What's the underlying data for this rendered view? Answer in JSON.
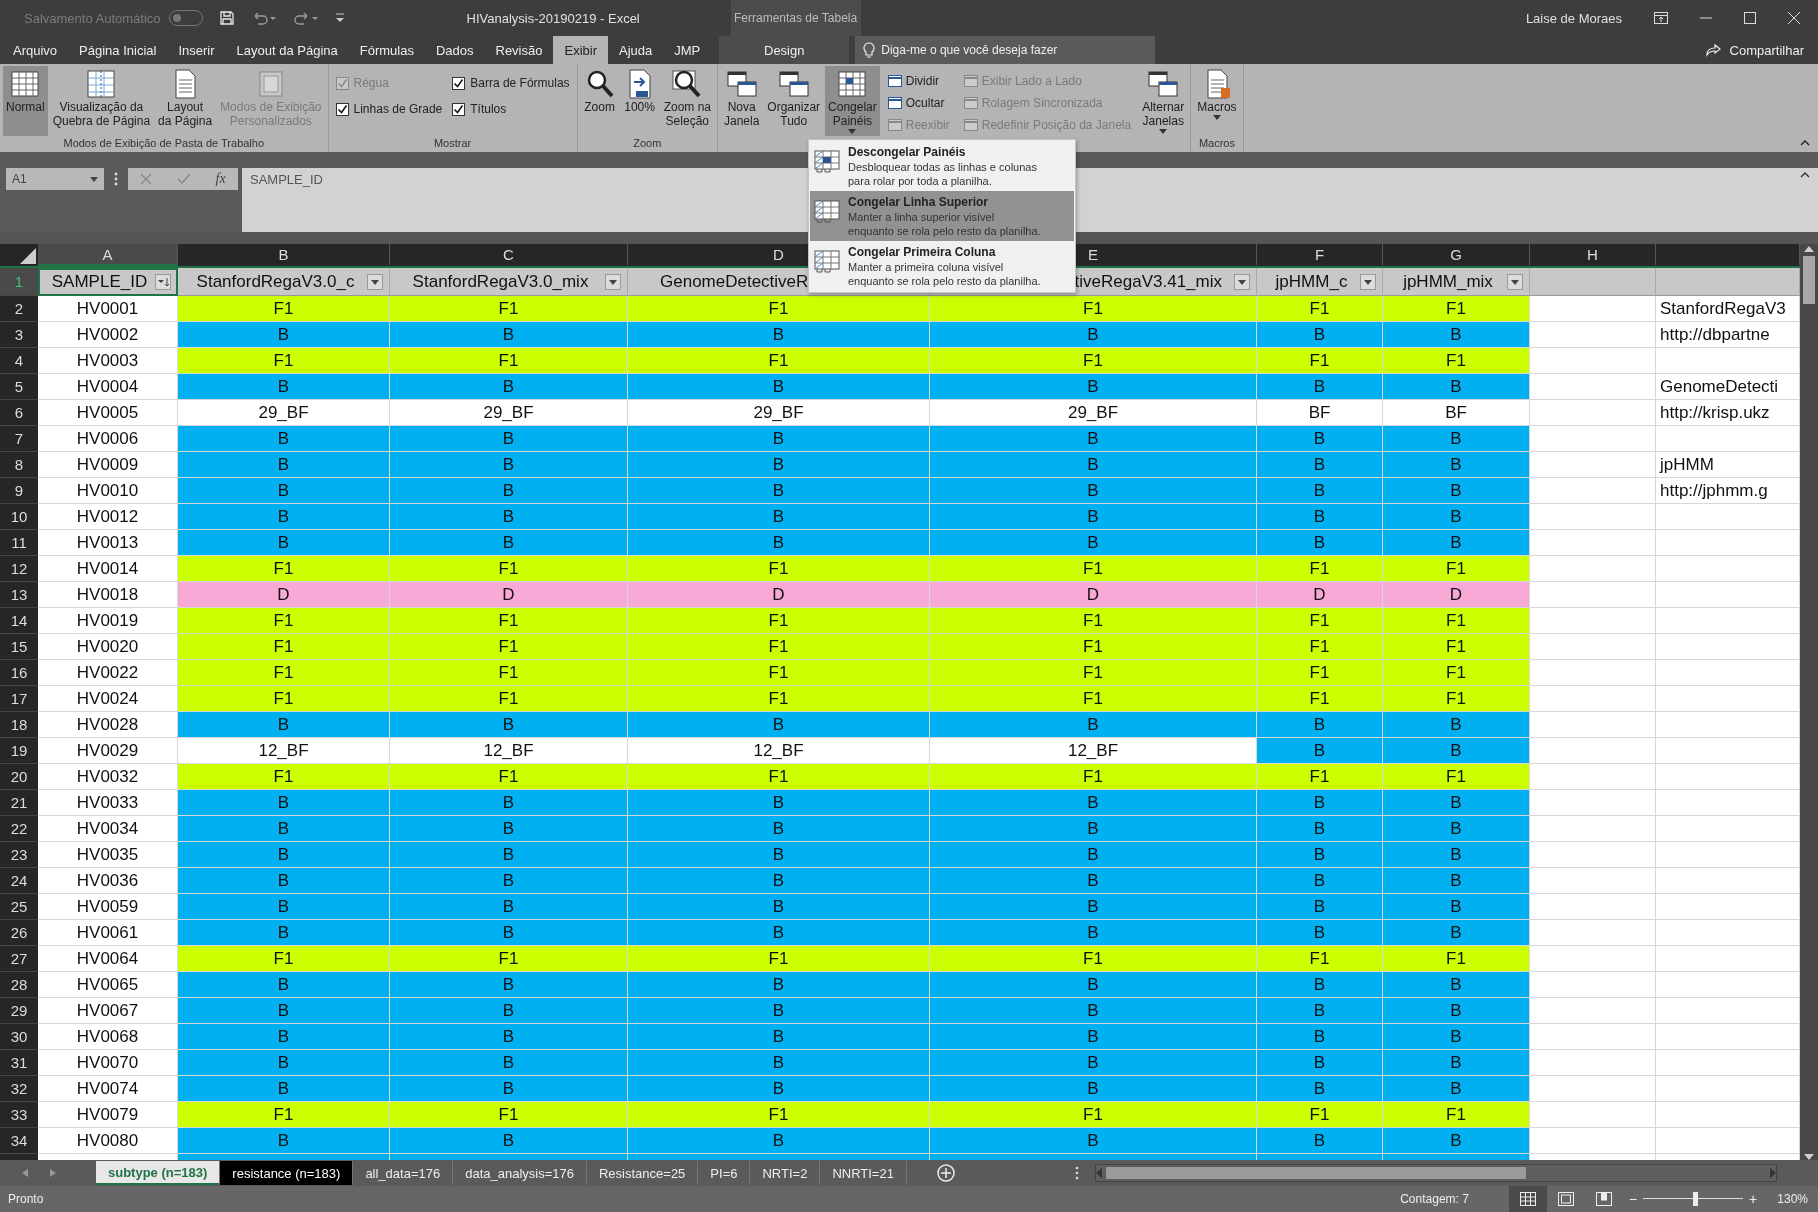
{
  "title_bar": {
    "autosave_label": "Salvamento Automático",
    "autosave_on": false,
    "title": "HIVanalysis-20190219  -  Excel",
    "context_label": "Ferramentas de Tabela",
    "user": "Laise de Moraes"
  },
  "tabs": [
    {
      "label": "Arquivo",
      "selected": false
    },
    {
      "label": "Página Inicial",
      "selected": false
    },
    {
      "label": "Inserir",
      "selected": false
    },
    {
      "label": "Layout da Página",
      "selected": false
    },
    {
      "label": "Fórmulas",
      "selected": false
    },
    {
      "label": "Dados",
      "selected": false
    },
    {
      "label": "Revisão",
      "selected": false
    },
    {
      "label": "Exibir",
      "selected": true
    },
    {
      "label": "Ajuda",
      "selected": false
    },
    {
      "label": "JMP",
      "selected": false
    }
  ],
  "context_tabs": [
    {
      "label": "Design",
      "selected": false
    }
  ],
  "tell_me": "Diga-me o que você deseja fazer",
  "share": "Compartilhar",
  "ribbon_groups": [
    {
      "label": "Modos de Exibição de Pasta de Trabalho",
      "items": [
        {
          "kind": "large",
          "label": "Normal",
          "selected": true,
          "disabled": false,
          "has_menu": false
        },
        {
          "kind": "large",
          "label": "Visualização da\nQuebra de Página",
          "selected": false,
          "disabled": false,
          "has_menu": false
        },
        {
          "kind": "large",
          "label": "Layout\nda Página",
          "selected": false,
          "disabled": false,
          "has_menu": false
        },
        {
          "kind": "large",
          "label": "Modos de Exibição\nPersonalizados",
          "selected": false,
          "disabled": true,
          "has_menu": false
        }
      ]
    },
    {
      "label": "Mostrar",
      "items": [
        {
          "kind": "stack",
          "items": [
            {
              "kind": "check",
              "label": "Régua",
              "checked": true,
              "disabled": true
            },
            {
              "kind": "check",
              "label": "Linhas de Grade",
              "checked": true,
              "disabled": false
            }
          ]
        },
        {
          "kind": "stack",
          "items": [
            {
              "kind": "check",
              "label": "Barra de Fórmulas",
              "checked": true,
              "disabled": false
            },
            {
              "kind": "check",
              "label": "Títulos",
              "checked": true,
              "disabled": false
            }
          ]
        }
      ]
    },
    {
      "label": "Zoom",
      "items": [
        {
          "kind": "large",
          "label": "Zoom",
          "selected": false,
          "disabled": false,
          "has_menu": false
        },
        {
          "kind": "large",
          "label": "100%",
          "selected": false,
          "disabled": false,
          "has_menu": false
        },
        {
          "kind": "large",
          "label": "Zoom na\nSeleção",
          "selected": false,
          "disabled": false,
          "has_menu": false
        }
      ]
    },
    {
      "items": [
        {
          "kind": "large",
          "label": "Nova\nJanela",
          "selected": false,
          "disabled": false,
          "has_menu": false
        },
        {
          "kind": "large",
          "label": "Organizar\nTudo",
          "selected": false,
          "disabled": false,
          "has_menu": false
        },
        {
          "kind": "large",
          "label": "Congelar\nPainéis",
          "selected": true,
          "disabled": false,
          "has_menu": true
        },
        {
          "kind": "stack",
          "items": [
            {
              "kind": "small",
              "label": "Dividir",
              "disabled": false
            },
            {
              "kind": "small",
              "label": "Ocultar",
              "disabled": false
            },
            {
              "kind": "small",
              "label": "Reexibir",
              "disabled": true
            }
          ]
        },
        {
          "kind": "stack",
          "items": [
            {
              "kind": "small",
              "label": "Exibir Lado a Lado",
              "disabled": true
            },
            {
              "kind": "small",
              "label": "Rolagem Sincronizada",
              "disabled": true
            },
            {
              "kind": "small",
              "label": "Redefinir Posição da Janela",
              "disabled": true
            }
          ]
        },
        {
          "kind": "large",
          "label": "Alternar\nJanelas",
          "selected": false,
          "disabled": false,
          "has_menu": true
        }
      ]
    },
    {
      "label": "Macros",
      "items": [
        {
          "kind": "large",
          "label": "Macros",
          "selected": false,
          "disabled": false,
          "has_menu": true
        }
      ]
    }
  ],
  "freeze_menu": [
    {
      "title": "Descongelar Painéis",
      "description": "Desbloquear todas as linhas e colunas\npara rolar por toda a planilha.",
      "selected": false
    },
    {
      "title": "Congelar Linha Superior",
      "description": "Manter a linha superior visível\nenquanto se rola pelo resto da planilha.",
      "selected": true
    },
    {
      "title": "Congelar Primeira Coluna",
      "description": "Manter a primeira coluna visível\nenquanto se rola pelo resto da planilha.",
      "selected": false
    }
  ],
  "formula_bar": {
    "name_box": "A1",
    "fx": "fx",
    "formula": "SAMPLE_ID"
  },
  "sheet": {
    "columns": [
      {
        "letter": "A",
        "selected": true
      },
      {
        "letter": "B",
        "selected": false
      },
      {
        "letter": "C",
        "selected": false
      },
      {
        "letter": "D",
        "selected": false
      },
      {
        "letter": "E",
        "selected": false
      },
      {
        "letter": "F",
        "selected": false
      },
      {
        "letter": "G",
        "selected": false
      },
      {
        "letter": "H",
        "selected": false
      }
    ],
    "header_row": {
      "number": "1",
      "selected": true,
      "cells": [
        {
          "text": "SAMPLE_ID",
          "filter": true
        },
        {
          "text": "StanfordRegaV3.0_c",
          "filter": true
        },
        {
          "text": "StanfordRegaV3.0_mix",
          "filter": true
        },
        {
          "text": "GenomeDetectiveR",
          "filter": false
        },
        {
          "text": "tiveRegaV3.41_mix",
          "filter": true
        },
        {
          "text": "jpHMM_c",
          "filter": true
        },
        {
          "text": "jpHMM_mix",
          "filter": true
        }
      ]
    },
    "rows": [
      {
        "number": "2",
        "id": "HV0001",
        "values": [
          {
            "text": "F1",
            "color": "#ccff00"
          },
          {
            "text": "F1",
            "color": "#ccff00"
          },
          {
            "text": "F1",
            "color": "#ccff00"
          },
          {
            "text": "F1",
            "color": "#ccff00"
          },
          {
            "text": "F1",
            "color": "#ccff00"
          },
          {
            "text": "F1",
            "color": "#ccff00"
          }
        ],
        "note": "StanfordRegaV3"
      },
      {
        "number": "3",
        "id": "HV0002",
        "values": [
          {
            "text": "B",
            "color": "#00b0f0"
          },
          {
            "text": "B",
            "color": "#00b0f0"
          },
          {
            "text": "B",
            "color": "#00b0f0"
          },
          {
            "text": "B",
            "color": "#00b0f0"
          },
          {
            "text": "B",
            "color": "#00b0f0"
          },
          {
            "text": "B",
            "color": "#00b0f0"
          }
        ],
        "note": "http://dbpartne"
      },
      {
        "number": "4",
        "id": "HV0003",
        "values": [
          {
            "text": "F1",
            "color": "#ccff00"
          },
          {
            "text": "F1",
            "color": "#ccff00"
          },
          {
            "text": "F1",
            "color": "#ccff00"
          },
          {
            "text": "F1",
            "color": "#ccff00"
          },
          {
            "text": "F1",
            "color": "#ccff00"
          },
          {
            "text": "F1",
            "color": "#ccff00"
          }
        ]
      },
      {
        "number": "5",
        "id": "HV0004",
        "values": [
          {
            "text": "B",
            "color": "#00b0f0"
          },
          {
            "text": "B",
            "color": "#00b0f0"
          },
          {
            "text": "B",
            "color": "#00b0f0"
          },
          {
            "text": "B",
            "color": "#00b0f0"
          },
          {
            "text": "B",
            "color": "#00b0f0"
          },
          {
            "text": "B",
            "color": "#00b0f0"
          }
        ],
        "note": "GenomeDetecti"
      },
      {
        "number": "6",
        "id": "HV0005",
        "values": [
          {
            "text": "29_BF",
            "color": "#ffffff"
          },
          {
            "text": "29_BF",
            "color": "#ffffff"
          },
          {
            "text": "29_BF",
            "color": "#ffffff"
          },
          {
            "text": "29_BF",
            "color": "#ffffff"
          },
          {
            "text": "BF",
            "color": "#ffffff"
          },
          {
            "text": "BF",
            "color": "#ffffff"
          }
        ],
        "note": "http://krisp.ukz"
      },
      {
        "number": "7",
        "id": "HV0006",
        "values": [
          {
            "text": "B",
            "color": "#00b0f0"
          },
          {
            "text": "B",
            "color": "#00b0f0"
          },
          {
            "text": "B",
            "color": "#00b0f0"
          },
          {
            "text": "B",
            "color": "#00b0f0"
          },
          {
            "text": "B",
            "color": "#00b0f0"
          },
          {
            "text": "B",
            "color": "#00b0f0"
          }
        ]
      },
      {
        "number": "8",
        "id": "HV0009",
        "values": [
          {
            "text": "B",
            "color": "#00b0f0"
          },
          {
            "text": "B",
            "color": "#00b0f0"
          },
          {
            "text": "B",
            "color": "#00b0f0"
          },
          {
            "text": "B",
            "color": "#00b0f0"
          },
          {
            "text": "B",
            "color": "#00b0f0"
          },
          {
            "text": "B",
            "color": "#00b0f0"
          }
        ],
        "note": "jpHMM"
      },
      {
        "number": "9",
        "id": "HV0010",
        "values": [
          {
            "text": "B",
            "color": "#00b0f0"
          },
          {
            "text": "B",
            "color": "#00b0f0"
          },
          {
            "text": "B",
            "color": "#00b0f0"
          },
          {
            "text": "B",
            "color": "#00b0f0"
          },
          {
            "text": "B",
            "color": "#00b0f0"
          },
          {
            "text": "B",
            "color": "#00b0f0"
          }
        ],
        "note": "http://jphmm.g"
      },
      {
        "number": "10",
        "id": "HV0012",
        "values": [
          {
            "text": "B",
            "color": "#00b0f0"
          },
          {
            "text": "B",
            "color": "#00b0f0"
          },
          {
            "text": "B",
            "color": "#00b0f0"
          },
          {
            "text": "B",
            "color": "#00b0f0"
          },
          {
            "text": "B",
            "color": "#00b0f0"
          },
          {
            "text": "B",
            "color": "#00b0f0"
          }
        ]
      },
      {
        "number": "11",
        "id": "HV0013",
        "values": [
          {
            "text": "B",
            "color": "#00b0f0"
          },
          {
            "text": "B",
            "color": "#00b0f0"
          },
          {
            "text": "B",
            "color": "#00b0f0"
          },
          {
            "text": "B",
            "color": "#00b0f0"
          },
          {
            "text": "B",
            "color": "#00b0f0"
          },
          {
            "text": "B",
            "color": "#00b0f0"
          }
        ]
      },
      {
        "number": "12",
        "id": "HV0014",
        "values": [
          {
            "text": "F1",
            "color": "#ccff00"
          },
          {
            "text": "F1",
            "color": "#ccff00"
          },
          {
            "text": "F1",
            "color": "#ccff00"
          },
          {
            "text": "F1",
            "color": "#ccff00"
          },
          {
            "text": "F1",
            "color": "#ccff00"
          },
          {
            "text": "F1",
            "color": "#ccff00"
          }
        ]
      },
      {
        "number": "13",
        "id": "HV0018",
        "values": [
          {
            "text": "D",
            "color": "#f9a9d6"
          },
          {
            "text": "D",
            "color": "#f9a9d6"
          },
          {
            "text": "D",
            "color": "#f9a9d6"
          },
          {
            "text": "D",
            "color": "#f9a9d6"
          },
          {
            "text": "D",
            "color": "#f9a9d6"
          },
          {
            "text": "D",
            "color": "#f9a9d6"
          }
        ]
      },
      {
        "number": "14",
        "id": "HV0019",
        "values": [
          {
            "text": "F1",
            "color": "#ccff00"
          },
          {
            "text": "F1",
            "color": "#ccff00"
          },
          {
            "text": "F1",
            "color": "#ccff00"
          },
          {
            "text": "F1",
            "color": "#ccff00"
          },
          {
            "text": "F1",
            "color": "#ccff00"
          },
          {
            "text": "F1",
            "color": "#ccff00"
          }
        ]
      },
      {
        "number": "15",
        "id": "HV0020",
        "values": [
          {
            "text": "F1",
            "color": "#ccff00"
          },
          {
            "text": "F1",
            "color": "#ccff00"
          },
          {
            "text": "F1",
            "color": "#ccff00"
          },
          {
            "text": "F1",
            "color": "#ccff00"
          },
          {
            "text": "F1",
            "color": "#ccff00"
          },
          {
            "text": "F1",
            "color": "#ccff00"
          }
        ]
      },
      {
        "number": "16",
        "id": "HV0022",
        "values": [
          {
            "text": "F1",
            "color": "#ccff00"
          },
          {
            "text": "F1",
            "color": "#ccff00"
          },
          {
            "text": "F1",
            "color": "#ccff00"
          },
          {
            "text": "F1",
            "color": "#ccff00"
          },
          {
            "text": "F1",
            "color": "#ccff00"
          },
          {
            "text": "F1",
            "color": "#ccff00"
          }
        ]
      },
      {
        "number": "17",
        "id": "HV0024",
        "values": [
          {
            "text": "F1",
            "color": "#ccff00"
          },
          {
            "text": "F1",
            "color": "#ccff00"
          },
          {
            "text": "F1",
            "color": "#ccff00"
          },
          {
            "text": "F1",
            "color": "#ccff00"
          },
          {
            "text": "F1",
            "color": "#ccff00"
          },
          {
            "text": "F1",
            "color": "#ccff00"
          }
        ]
      },
      {
        "number": "18",
        "id": "HV0028",
        "values": [
          {
            "text": "B",
            "color": "#00b0f0"
          },
          {
            "text": "B",
            "color": "#00b0f0"
          },
          {
            "text": "B",
            "color": "#00b0f0"
          },
          {
            "text": "B",
            "color": "#00b0f0"
          },
          {
            "text": "B",
            "color": "#00b0f0"
          },
          {
            "text": "B",
            "color": "#00b0f0"
          }
        ]
      },
      {
        "number": "19",
        "id": "HV0029",
        "values": [
          {
            "text": "12_BF",
            "color": "#ffffff"
          },
          {
            "text": "12_BF",
            "color": "#ffffff"
          },
          {
            "text": "12_BF",
            "color": "#ffffff"
          },
          {
            "text": "12_BF",
            "color": "#ffffff"
          },
          {
            "text": "B",
            "color": "#00b0f0"
          },
          {
            "text": "B",
            "color": "#00b0f0"
          }
        ]
      },
      {
        "number": "20",
        "id": "HV0032",
        "values": [
          {
            "text": "F1",
            "color": "#ccff00"
          },
          {
            "text": "F1",
            "color": "#ccff00"
          },
          {
            "text": "F1",
            "color": "#ccff00"
          },
          {
            "text": "F1",
            "color": "#ccff00"
          },
          {
            "text": "F1",
            "color": "#ccff00"
          },
          {
            "text": "F1",
            "color": "#ccff00"
          }
        ]
      },
      {
        "number": "21",
        "id": "HV0033",
        "values": [
          {
            "text": "B",
            "color": "#00b0f0"
          },
          {
            "text": "B",
            "color": "#00b0f0"
          },
          {
            "text": "B",
            "color": "#00b0f0"
          },
          {
            "text": "B",
            "color": "#00b0f0"
          },
          {
            "text": "B",
            "color": "#00b0f0"
          },
          {
            "text": "B",
            "color": "#00b0f0"
          }
        ]
      },
      {
        "number": "22",
        "id": "HV0034",
        "values": [
          {
            "text": "B",
            "color": "#00b0f0"
          },
          {
            "text": "B",
            "color": "#00b0f0"
          },
          {
            "text": "B",
            "color": "#00b0f0"
          },
          {
            "text": "B",
            "color": "#00b0f0"
          },
          {
            "text": "B",
            "color": "#00b0f0"
          },
          {
            "text": "B",
            "color": "#00b0f0"
          }
        ]
      },
      {
        "number": "23",
        "id": "HV0035",
        "values": [
          {
            "text": "B",
            "color": "#00b0f0"
          },
          {
            "text": "B",
            "color": "#00b0f0"
          },
          {
            "text": "B",
            "color": "#00b0f0"
          },
          {
            "text": "B",
            "color": "#00b0f0"
          },
          {
            "text": "B",
            "color": "#00b0f0"
          },
          {
            "text": "B",
            "color": "#00b0f0"
          }
        ]
      },
      {
        "number": "24",
        "id": "HV0036",
        "values": [
          {
            "text": "B",
            "color": "#00b0f0"
          },
          {
            "text": "B",
            "color": "#00b0f0"
          },
          {
            "text": "B",
            "color": "#00b0f0"
          },
          {
            "text": "B",
            "color": "#00b0f0"
          },
          {
            "text": "B",
            "color": "#00b0f0"
          },
          {
            "text": "B",
            "color": "#00b0f0"
          }
        ]
      },
      {
        "number": "25",
        "id": "HV0059",
        "values": [
          {
            "text": "B",
            "color": "#00b0f0"
          },
          {
            "text": "B",
            "color": "#00b0f0"
          },
          {
            "text": "B",
            "color": "#00b0f0"
          },
          {
            "text": "B",
            "color": "#00b0f0"
          },
          {
            "text": "B",
            "color": "#00b0f0"
          },
          {
            "text": "B",
            "color": "#00b0f0"
          }
        ]
      },
      {
        "number": "26",
        "id": "HV0061",
        "values": [
          {
            "text": "B",
            "color": "#00b0f0"
          },
          {
            "text": "B",
            "color": "#00b0f0"
          },
          {
            "text": "B",
            "color": "#00b0f0"
          },
          {
            "text": "B",
            "color": "#00b0f0"
          },
          {
            "text": "B",
            "color": "#00b0f0"
          },
          {
            "text": "B",
            "color": "#00b0f0"
          }
        ]
      },
      {
        "number": "27",
        "id": "HV0064",
        "values": [
          {
            "text": "F1",
            "color": "#ccff00"
          },
          {
            "text": "F1",
            "color": "#ccff00"
          },
          {
            "text": "F1",
            "color": "#ccff00"
          },
          {
            "text": "F1",
            "color": "#ccff00"
          },
          {
            "text": "F1",
            "color": "#ccff00"
          },
          {
            "text": "F1",
            "color": "#ccff00"
          }
        ]
      },
      {
        "number": "28",
        "id": "HV0065",
        "values": [
          {
            "text": "B",
            "color": "#00b0f0"
          },
          {
            "text": "B",
            "color": "#00b0f0"
          },
          {
            "text": "B",
            "color": "#00b0f0"
          },
          {
            "text": "B",
            "color": "#00b0f0"
          },
          {
            "text": "B",
            "color": "#00b0f0"
          },
          {
            "text": "B",
            "color": "#00b0f0"
          }
        ]
      },
      {
        "number": "29",
        "id": "HV0067",
        "values": [
          {
            "text": "B",
            "color": "#00b0f0"
          },
          {
            "text": "B",
            "color": "#00b0f0"
          },
          {
            "text": "B",
            "color": "#00b0f0"
          },
          {
            "text": "B",
            "color": "#00b0f0"
          },
          {
            "text": "B",
            "color": "#00b0f0"
          },
          {
            "text": "B",
            "color": "#00b0f0"
          }
        ]
      },
      {
        "number": "30",
        "id": "HV0068",
        "values": [
          {
            "text": "B",
            "color": "#00b0f0"
          },
          {
            "text": "B",
            "color": "#00b0f0"
          },
          {
            "text": "B",
            "color": "#00b0f0"
          },
          {
            "text": "B",
            "color": "#00b0f0"
          },
          {
            "text": "B",
            "color": "#00b0f0"
          },
          {
            "text": "B",
            "color": "#00b0f0"
          }
        ]
      },
      {
        "number": "31",
        "id": "HV0070",
        "values": [
          {
            "text": "B",
            "color": "#00b0f0"
          },
          {
            "text": "B",
            "color": "#00b0f0"
          },
          {
            "text": "B",
            "color": "#00b0f0"
          },
          {
            "text": "B",
            "color": "#00b0f0"
          },
          {
            "text": "B",
            "color": "#00b0f0"
          },
          {
            "text": "B",
            "color": "#00b0f0"
          }
        ]
      },
      {
        "number": "32",
        "id": "HV0074",
        "values": [
          {
            "text": "B",
            "color": "#00b0f0"
          },
          {
            "text": "B",
            "color": "#00b0f0"
          },
          {
            "text": "B",
            "color": "#00b0f0"
          },
          {
            "text": "B",
            "color": "#00b0f0"
          },
          {
            "text": "B",
            "color": "#00b0f0"
          },
          {
            "text": "B",
            "color": "#00b0f0"
          }
        ]
      },
      {
        "number": "33",
        "id": "HV0079",
        "values": [
          {
            "text": "F1",
            "color": "#ccff00"
          },
          {
            "text": "F1",
            "color": "#ccff00"
          },
          {
            "text": "F1",
            "color": "#ccff00"
          },
          {
            "text": "F1",
            "color": "#ccff00"
          },
          {
            "text": "F1",
            "color": "#ccff00"
          },
          {
            "text": "F1",
            "color": "#ccff00"
          }
        ]
      },
      {
        "number": "34",
        "id": "HV0080",
        "values": [
          {
            "text": "B",
            "color": "#00b0f0"
          },
          {
            "text": "B",
            "color": "#00b0f0"
          },
          {
            "text": "B",
            "color": "#00b0f0"
          },
          {
            "text": "B",
            "color": "#00b0f0"
          },
          {
            "text": "B",
            "color": "#00b0f0"
          },
          {
            "text": "B",
            "color": "#00b0f0"
          }
        ]
      }
    ]
  },
  "sheet_tabs": [
    {
      "label": "subtype (n=183)",
      "selected": true
    },
    {
      "label": "resistance (n=183)",
      "selected": false,
      "color": "#000000"
    },
    {
      "label": "all_data=176",
      "selected": false
    },
    {
      "label": "data_analysis=176",
      "selected": false
    },
    {
      "label": "Resistance=25",
      "selected": false
    },
    {
      "label": "PI=6",
      "selected": false
    },
    {
      "label": "NRTI=2",
      "selected": false
    },
    {
      "label": "NNRTI=21",
      "selected": false
    }
  ],
  "status_bar": {
    "status": "Pronto",
    "count": "Contagem: 7",
    "views": [
      {
        "selected": true
      },
      {
        "selected": false
      },
      {
        "selected": false
      }
    ],
    "zoom_minus": "−",
    "zoom_plus": "+",
    "zoom": {
      "level": 0.52
    },
    "zoom_reading": "130%"
  }
}
